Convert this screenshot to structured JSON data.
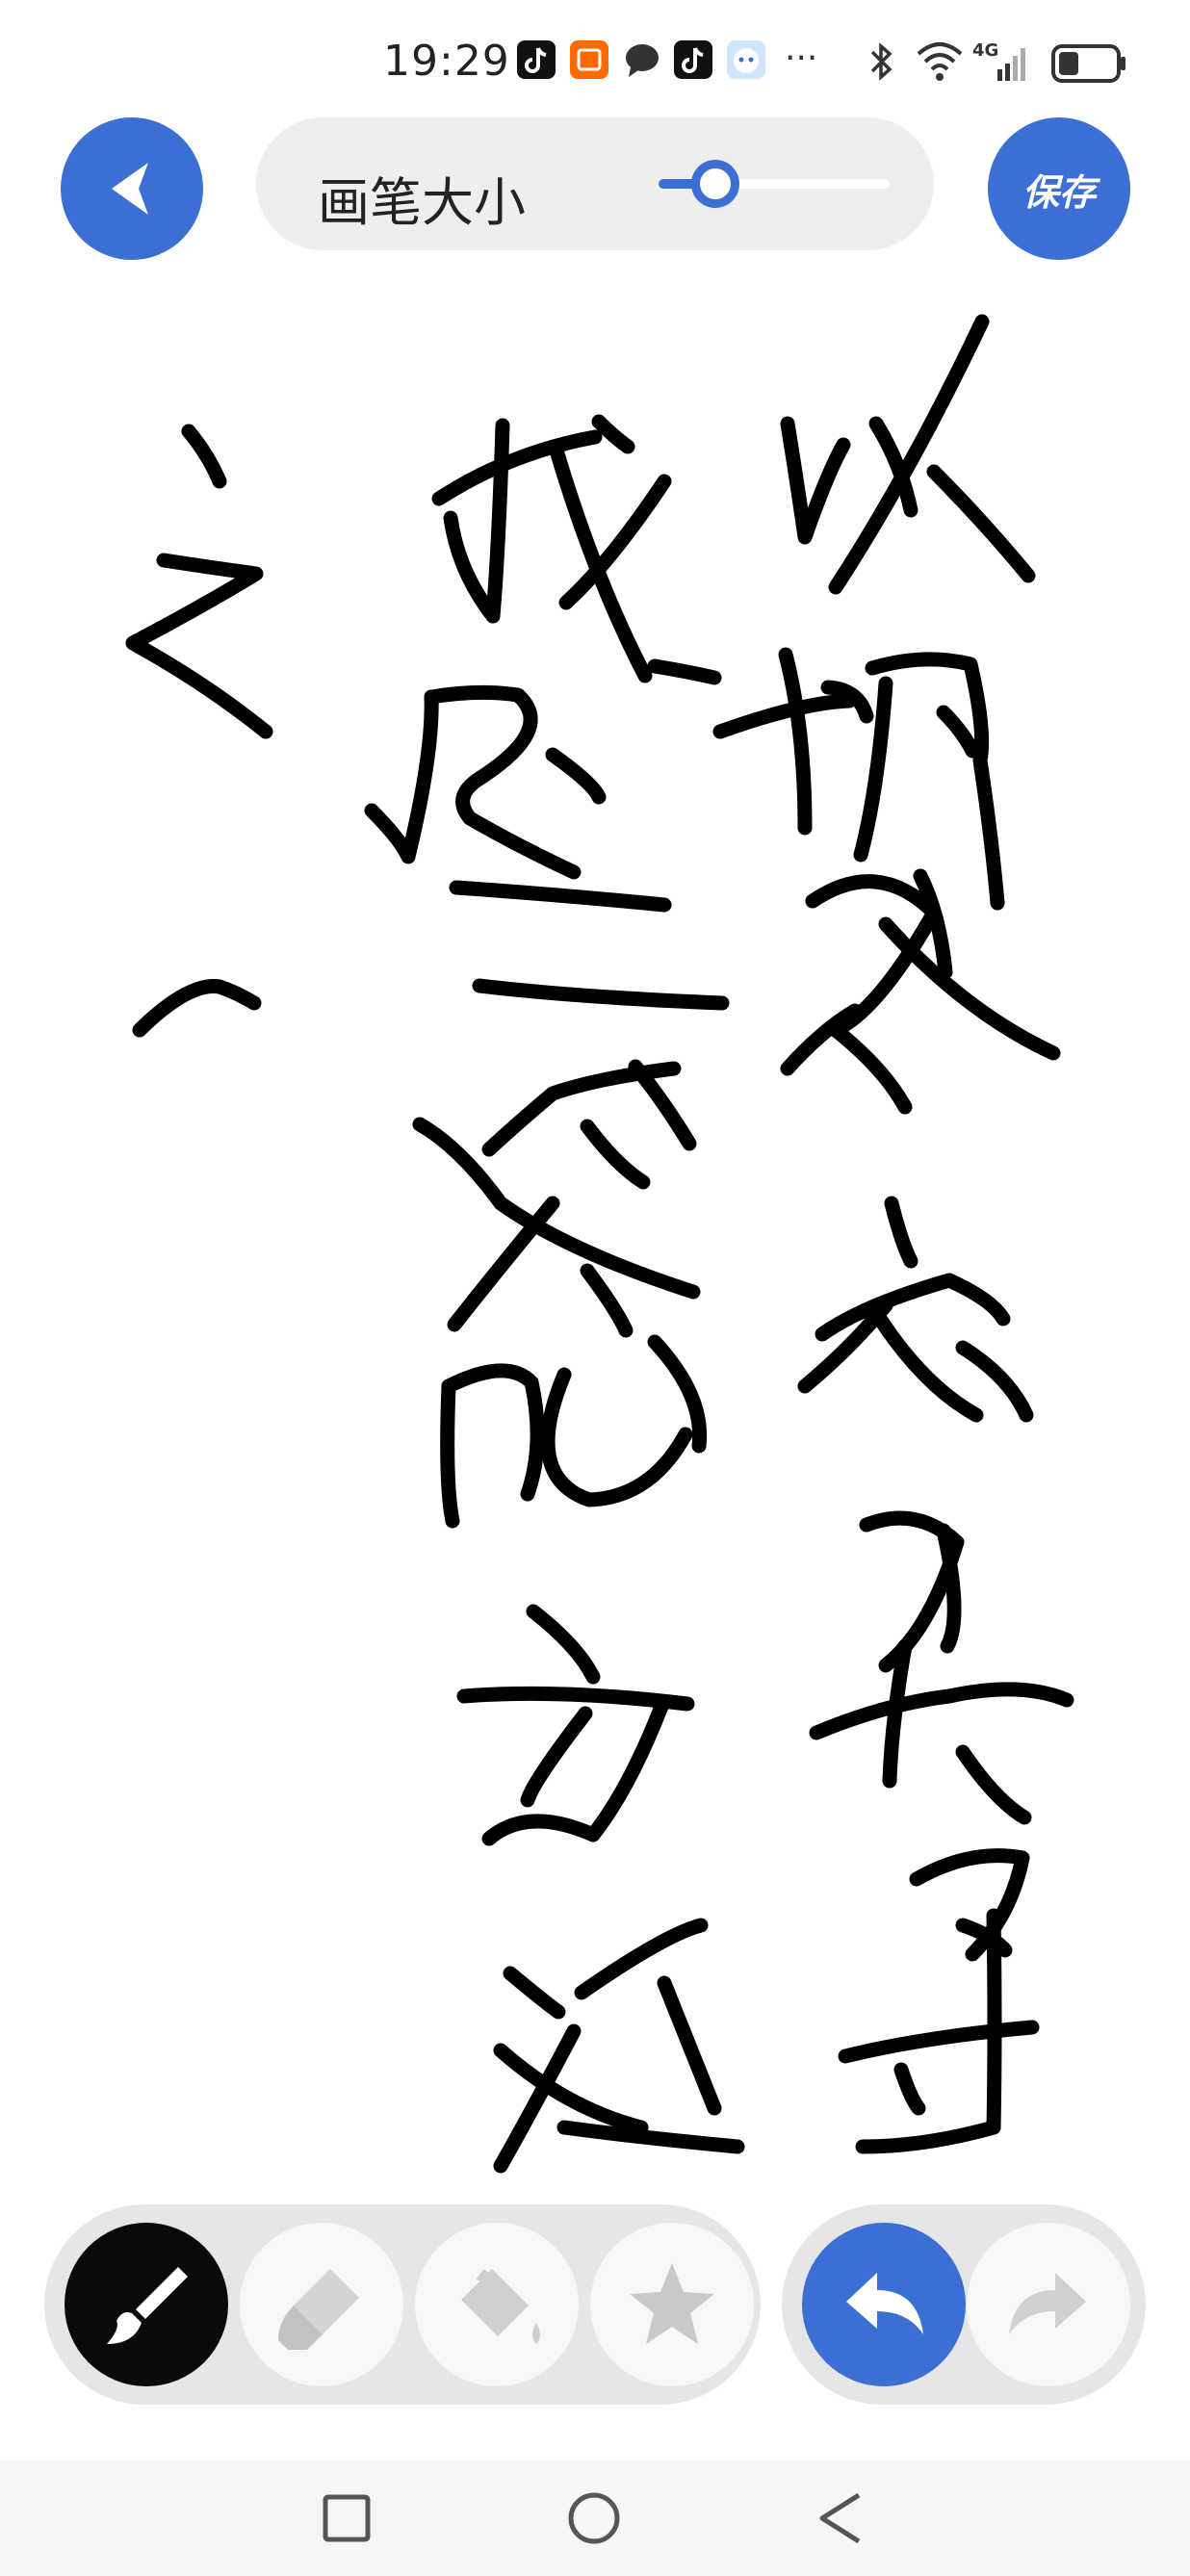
{
  "status_bar": {
    "time": "19:29",
    "app_icons": [
      "tiktok-icon",
      "taobao-icon",
      "message-icon",
      "tiktok-icon",
      "assistant-icon"
    ],
    "more": "···",
    "network": "4G",
    "battery_level": 0.35
  },
  "toolbar": {
    "back_icon": "back-arrow-icon",
    "brush_size_label": "画笔大小",
    "brush_size_value": 0.18,
    "save_label": "保存",
    "accent_color": "#3b6fd4"
  },
  "canvas": {
    "ink_color": "#000000",
    "background_color": "#ffffff"
  },
  "tools": {
    "items": [
      {
        "name": "brush-tool",
        "icon": "brush-icon",
        "selected": true
      },
      {
        "name": "eraser-tool",
        "icon": "eraser-icon",
        "selected": false
      },
      {
        "name": "fill-tool",
        "icon": "paint-bucket-icon",
        "selected": false
      },
      {
        "name": "stamp-tool",
        "icon": "star-icon",
        "selected": false
      }
    ],
    "history": [
      {
        "name": "undo-button",
        "icon": "undo-icon",
        "enabled": true
      },
      {
        "name": "redo-button",
        "icon": "redo-icon",
        "enabled": false
      }
    ]
  },
  "nav_bar": {
    "buttons": [
      "recent-apps-icon",
      "home-icon",
      "back-icon"
    ]
  }
}
